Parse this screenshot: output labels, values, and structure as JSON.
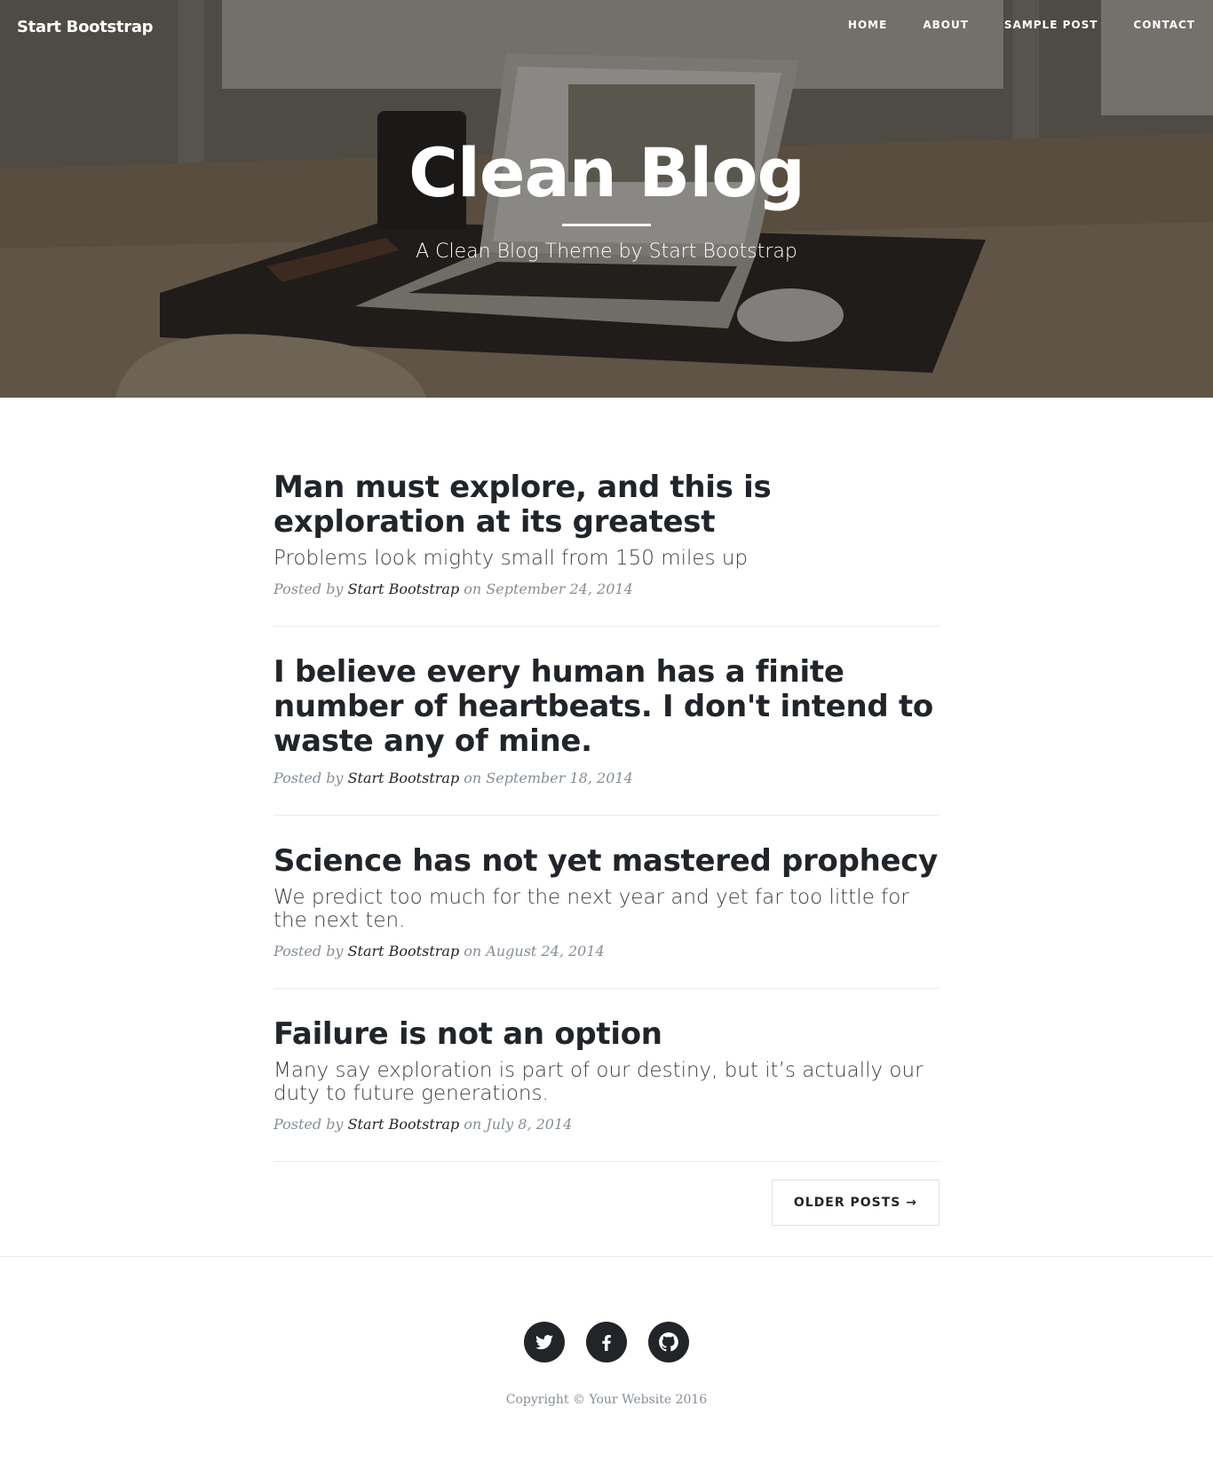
{
  "nav": {
    "brand": "Start Bootstrap",
    "links": [
      "HOME",
      "ABOUT",
      "SAMPLE POST",
      "CONTACT"
    ]
  },
  "header": {
    "title": "Clean Blog",
    "subtitle": "A Clean Blog Theme by Start Bootstrap"
  },
  "posts": [
    {
      "title": "Man must explore, and this is exploration at its greatest",
      "subtitle": "Problems look mighty small from 150 miles up",
      "meta_prefix": "Posted by",
      "author": "Start Bootstrap",
      "meta_date": "on September 24, 2014"
    },
    {
      "title": "I believe every human has a finite number of heartbeats. I don't intend to waste any of mine.",
      "subtitle": "",
      "meta_prefix": "Posted by",
      "author": "Start Bootstrap",
      "meta_date": "on September 18, 2014"
    },
    {
      "title": "Science has not yet mastered prophecy",
      "subtitle": "We predict too much for the next year and yet far too little for the next ten.",
      "meta_prefix": "Posted by",
      "author": "Start Bootstrap",
      "meta_date": "on August 24, 2014"
    },
    {
      "title": "Failure is not an option",
      "subtitle": "Many say exploration is part of our destiny, but it’s actually our duty to future generations.",
      "meta_prefix": "Posted by",
      "author": "Start Bootstrap",
      "meta_date": "on July 8, 2014"
    }
  ],
  "pager": {
    "older_label": "OLDER POSTS →"
  },
  "footer": {
    "social": [
      "twitter-icon",
      "facebook-icon",
      "github-icon"
    ],
    "copyright": "Copyright © Your Website 2016"
  },
  "colors": {
    "text_dark": "#212529",
    "meta_gray": "#868e96",
    "divider": "#e9ecef"
  }
}
